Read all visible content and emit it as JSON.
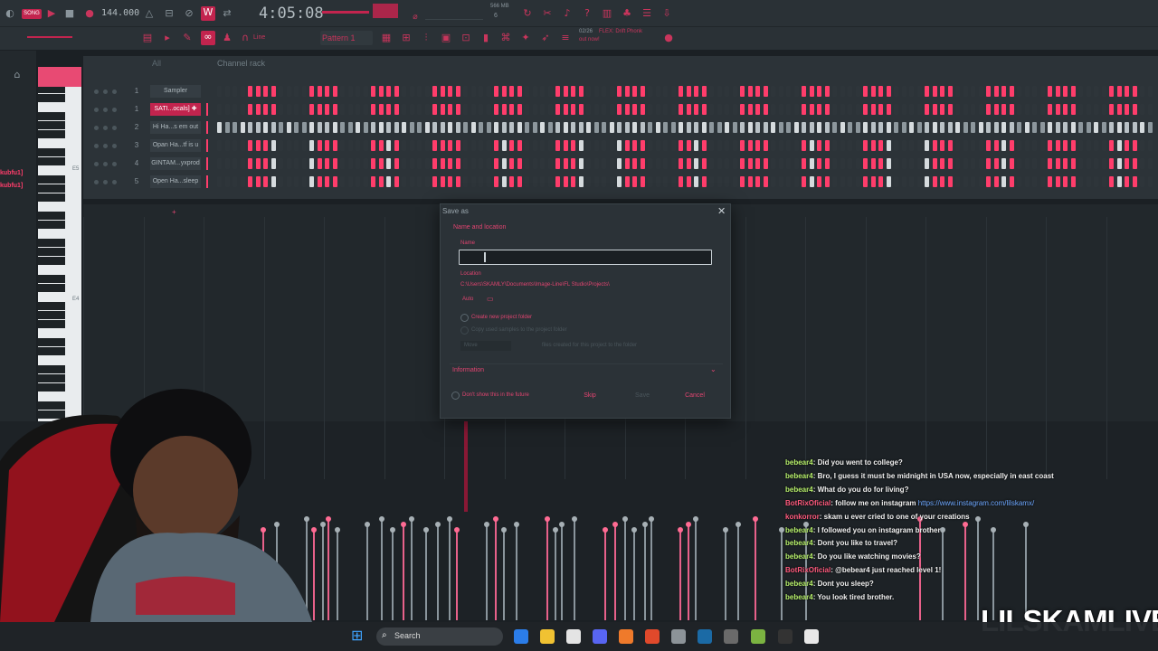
{
  "toolbar": {
    "song_mode": "SONG",
    "tempo": "144.000",
    "time": "4:05:08",
    "cpu_label": "566 MB",
    "cpu_value": "6",
    "snap": "Line",
    "pattern": "Pattern 1",
    "hint_date": "02/26",
    "hint_text": "FLEX: Drift Phonk",
    "hint_sub": "out now!"
  },
  "browser": {
    "labels": [
      "kubfu1]",
      "kubfu1]"
    ]
  },
  "piano": {
    "labels": [
      "E5",
      "E4"
    ]
  },
  "channel_rack": {
    "header_all": "All",
    "title": "Channel rack",
    "channels": [
      {
        "num": "1",
        "name": "Sampler",
        "selected": false
      },
      {
        "num": "1",
        "name": "SATI...ocals] ✚",
        "selected": true
      },
      {
        "num": "2",
        "name": "Hi Ha...s em out",
        "selected": false
      },
      {
        "num": "3",
        "name": "Opan Ha...tf is u",
        "selected": false
      },
      {
        "num": "4",
        "name": "GINTAM...yxprod",
        "selected": false
      },
      {
        "num": "5",
        "name": "Open Ha...sleep",
        "selected": false
      }
    ]
  },
  "dialog": {
    "title": "Save as",
    "section": "Name and location",
    "name_label": "Name",
    "name_value": "",
    "location_label": "Location",
    "path": "C:\\Users\\SKAMLY\\Documents\\Image-Line\\FL Studio\\Projects\\",
    "auto": "Auto",
    "create_folder": "Create new project folder",
    "copy_samples": "Copy used samples to the project folder",
    "move_label": "Move",
    "files_note": "files created for this project to the folder",
    "information": "Information",
    "dont_show": "Don't show this in the future",
    "skip": "Skip",
    "save": "Save",
    "cancel": "Cancel"
  },
  "chat": [
    {
      "user": "bebear4",
      "msg": ": Did you went to college?"
    },
    {
      "user": "bebear4",
      "msg": ": Bro, I guess it must be midnight in USA now, especially in east coast"
    },
    {
      "user": "bebear4",
      "msg": ": What do you do for living?"
    },
    {
      "user": "BotRixOficial",
      "msg": ": follow me on instagram ",
      "link": "https://www.instagram.com/lilskamx/"
    },
    {
      "user": "konkorror",
      "msg": ": skam u ever cried to one of your creations"
    },
    {
      "user": "bebear4",
      "msg": ": I followed you on instagram brother"
    },
    {
      "user": "bebear4",
      "msg": ": Dont you like to travel?"
    },
    {
      "user": "bebear4",
      "msg": ": Do you like watching movies?"
    },
    {
      "user": "BotRixOficial",
      "msg": ": @bebear4 just reached level 1!"
    },
    {
      "user": "bebear4",
      "msg": ": Dont you sleep?"
    },
    {
      "user": "bebear4",
      "msg": ": You look tired brother."
    }
  ],
  "taskbar": {
    "search": "Search"
  },
  "watermark": "LILSKAMLIVE",
  "colors": {
    "accent": "#e84a73",
    "bg": "#1b2024",
    "panel": "#2c3338"
  }
}
